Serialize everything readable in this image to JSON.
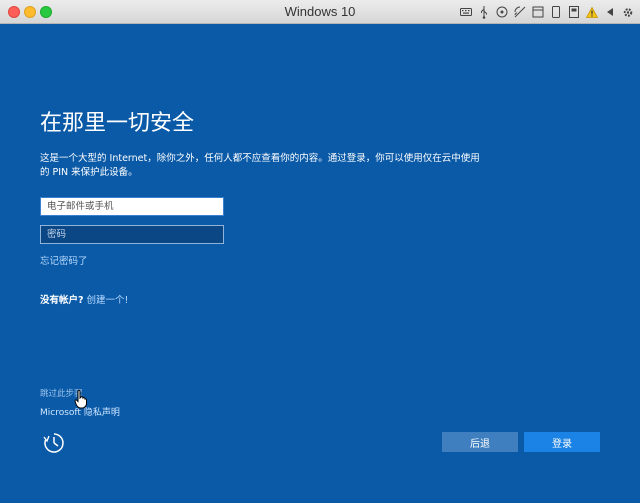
{
  "window": {
    "title": "Windows 10"
  },
  "titlebar_icons": [
    "keyboard-icon",
    "usb-icon",
    "disc-icon",
    "network-icon",
    "shared-folder-icon",
    "mobile-icon",
    "storage-icon",
    "warning-icon",
    "back-arrow-icon",
    "gear-icon"
  ],
  "signin": {
    "heading": "在那里一切安全",
    "description": "这是一个大型的 Internet，除你之外，任何人都不应查看你的内容。通过登录，你可以使用仅在云中使用的 PIN 来保护此设备。",
    "email_placeholder": "电子邮件或手机",
    "password_placeholder": "密码",
    "forgot_password": "忘记密码了",
    "no_account_label": "没有帐户?",
    "create_one": "创建一个!",
    "skip_step": "跳过此步骤",
    "privacy": "Microsoft 隐私声明",
    "back_button": "后退",
    "login_button": "登录"
  },
  "colors": {
    "background": "#0a5aa8",
    "login_button": "#1b82e6",
    "back_button": "#3f7fbf",
    "link": "#b9dcff"
  }
}
